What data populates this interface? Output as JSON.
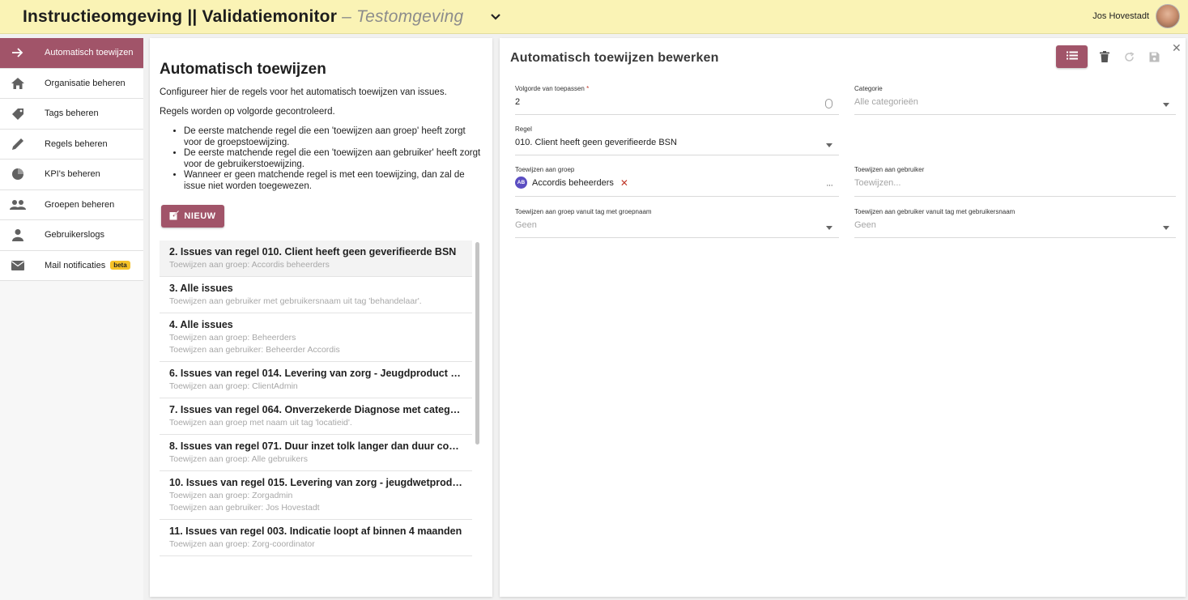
{
  "header": {
    "title": "Instructieomgeving || Validatiemonitor",
    "subtitle": "– Testomgeving",
    "user_name": "Jos Hovestadt"
  },
  "sidebar": {
    "items": [
      {
        "label": "Automatisch toewijzen",
        "icon": "arrow-right-icon"
      },
      {
        "label": "Organisatie beheren",
        "icon": "home-icon"
      },
      {
        "label": "Tags beheren",
        "icon": "tag-icon"
      },
      {
        "label": "Regels beheren",
        "icon": "pencil-icon"
      },
      {
        "label": "KPI's beheren",
        "icon": "pie-chart-icon"
      },
      {
        "label": "Groepen beheren",
        "icon": "group-icon"
      },
      {
        "label": "Gebruikerslogs",
        "icon": "person-icon"
      },
      {
        "label": "Mail notificaties",
        "icon": "mail-icon",
        "badge": "beta"
      }
    ]
  },
  "main": {
    "title": "Automatisch toewijzen",
    "description": "Configureer hier de regels voor het automatisch toewijzen van issues.",
    "order_note": "Regels worden op volgorde gecontroleerd.",
    "bullets": [
      "De eerste matchende regel die een 'toewijzen aan groep' heeft zorgt voor de groepstoewijzing.",
      "De eerste matchende regel die een 'toewijzen aan gebruiker' heeft zorgt voor de gebruikerstoewijzing.",
      "Wanneer er geen matchende regel is met een toewijzing, dan zal de issue niet worden toegewezen."
    ],
    "new_button": "NIEUW",
    "issues": [
      {
        "title": "2. Issues van regel 010. Client heeft geen geverifieerde BSN",
        "lines": [
          "Toewijzen aan groep: Accordis beheerders"
        ]
      },
      {
        "title": "3. Alle issues",
        "lines": [
          "Toewijzen aan gebruiker met gebruikersnaam uit tag 'behandelaar'."
        ]
      },
      {
        "title": "4. Alle issues",
        "lines": [
          "Toewijzen aan groep: Beheerders",
          "Toewijzen aan gebruiker: Beheerder Accordis"
        ]
      },
      {
        "title": "6. Issues van regel 014. Levering van zorg - Jeugdproduct me...",
        "lines": [
          "Toewijzen aan groep: ClientAdmin"
        ]
      },
      {
        "title": "7. Issues van regel 064. Onverzekerde Diagnose met categor...",
        "lines": [
          "Toewijzen aan groep met naam uit tag 'locatieid'."
        ]
      },
      {
        "title": "8. Issues van regel 071. Duur inzet tolk langer dan duur consu...",
        "lines": [
          "Toewijzen aan groep: Alle gebruikers"
        ]
      },
      {
        "title": "10. Issues van regel 015. Levering van zorg - jeugdwetproduc...",
        "lines": [
          "Toewijzen aan groep: Zorgadmin",
          "Toewijzen aan gebruiker: Jos Hovestadt"
        ]
      },
      {
        "title": "11. Issues van regel 003. Indicatie loopt af binnen 4 maanden",
        "lines": [
          "Toewijzen aan groep: Zorg-coordinator"
        ]
      }
    ]
  },
  "editor": {
    "title": "Automatisch toewijzen bewerken",
    "fields": {
      "volgorde": {
        "label": "Volgorde van toepassen",
        "required_mark": "*",
        "value": "2"
      },
      "categorie": {
        "label": "Categorie",
        "value": "Alle categorieën"
      },
      "regel": {
        "label": "Regel",
        "value": "010. Client heeft geen geverifieerde BSN"
      },
      "toewijzen_groep": {
        "label": "Toewijzen aan groep",
        "chip_initials": "AB",
        "chip_label": "Accordis beheerders",
        "chip_remove": "✕",
        "more": "···"
      },
      "toewijzen_gebruiker": {
        "label": "Toewijzen aan gebruiker",
        "placeholder": "Toewijzen..."
      },
      "groep_tag": {
        "label": "Toewijzen aan groep vanuit tag met groepnaam",
        "value": "Geen"
      },
      "gebruiker_tag": {
        "label": "Toewijzen aan gebruiker vanuit tag met gebruikersnaam",
        "value": "Geen"
      }
    },
    "close": "✕"
  },
  "colors": {
    "accent": "#a15469",
    "header_bg": "#faf3b5",
    "beta_badge": "#f5c127",
    "chip_avatar": "#5b4ec2"
  }
}
